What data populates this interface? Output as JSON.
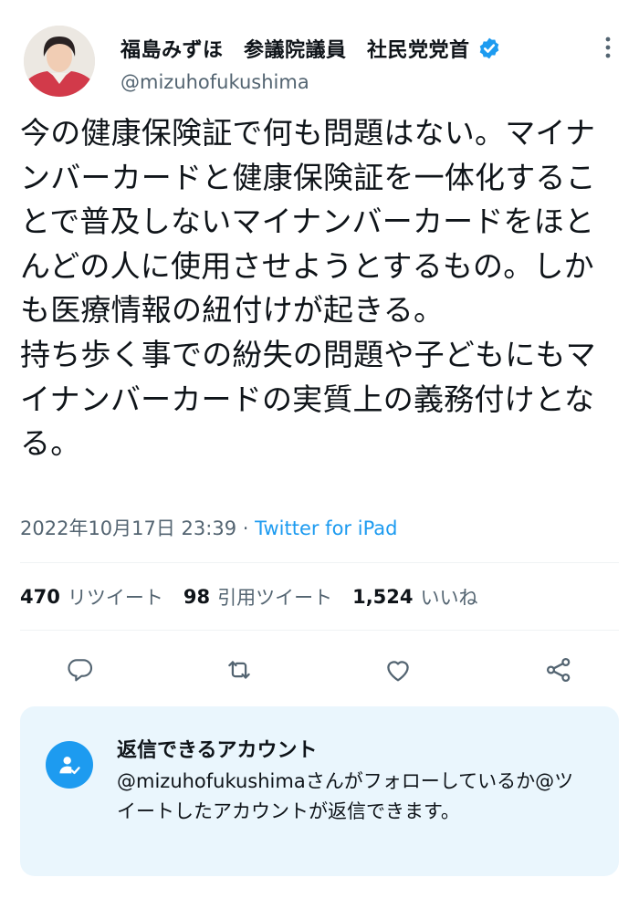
{
  "author": {
    "display_name": "福島みずほ　参議院議員　社民党党首",
    "handle": "@mizuhofukushima",
    "verified": true,
    "avatar_icon": "profile-photo"
  },
  "tweet": {
    "text": "今の健康保険証で何も問題はない。マイナンバーカードと健康保険証を一体化することで普及しないマイナンバーカードをほとんどの人に使用させようとするもの。しかも医療情報の紐付けが起きる。\n持ち歩く事での紛失の問題や子どもにもマイナンバーカードの実質上の義務付けとなる。",
    "timestamp": "2022年10月17日 23:39",
    "separator": " · ",
    "source": "Twitter for iPad"
  },
  "stats": {
    "retweets_count": "470",
    "retweets_label": "リツイート",
    "quotes_count": "98",
    "quotes_label": "引用ツイート",
    "likes_count": "1,524",
    "likes_label": "いいね"
  },
  "actions": {
    "reply_icon": "speech-bubble",
    "retweet_icon": "retweet-arrows",
    "like_icon": "heart",
    "share_icon": "share-nodes"
  },
  "reply_settings": {
    "title": "返信できるアカウント",
    "description": "@mizuhofukushimaさんがフォローしているか@ツイートしたアカウントが返信できます。",
    "icon": "user-check"
  },
  "colors": {
    "accent": "#1d9bf0",
    "text": "#0f1419",
    "secondary": "#536471",
    "reply_box_bg": "#eaf6fd"
  }
}
